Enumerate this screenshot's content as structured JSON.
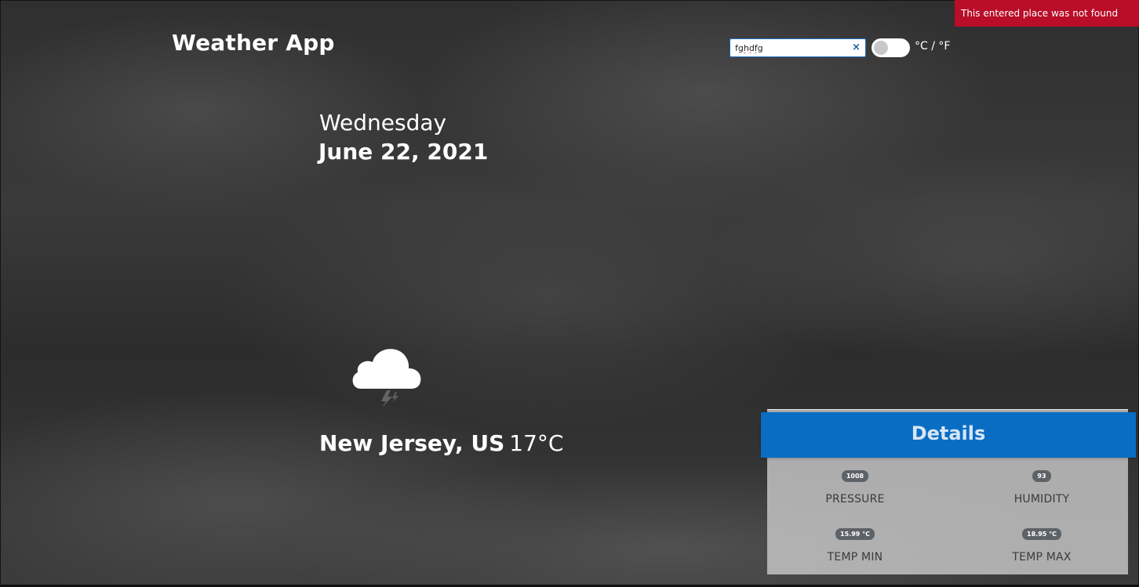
{
  "toast": {
    "message": "This entered place was not found"
  },
  "header": {
    "title": "Weather App",
    "search_value": "fghdfg",
    "clear_icon": "×",
    "unit_label": "°C / °F",
    "unit_toggle_state": "off"
  },
  "date": {
    "day": "Wednesday",
    "full": "June 22, 2021"
  },
  "weather": {
    "icon": "cloud-lightning-icon",
    "location": "New Jersey, US",
    "temperature": "17°C"
  },
  "details": {
    "title": "Details",
    "items": [
      {
        "value": "1008",
        "label": "PRESSURE"
      },
      {
        "value": "93",
        "label": "HUMIDITY"
      },
      {
        "value": "15.99 °C",
        "label": "TEMP MIN"
      },
      {
        "value": "18.95 °C",
        "label": "TEMP MAX"
      }
    ]
  },
  "colors": {
    "toast_bg": "#b90d28",
    "details_header_bg": "#0a6dc4",
    "badge_bg": "#5d6268"
  }
}
